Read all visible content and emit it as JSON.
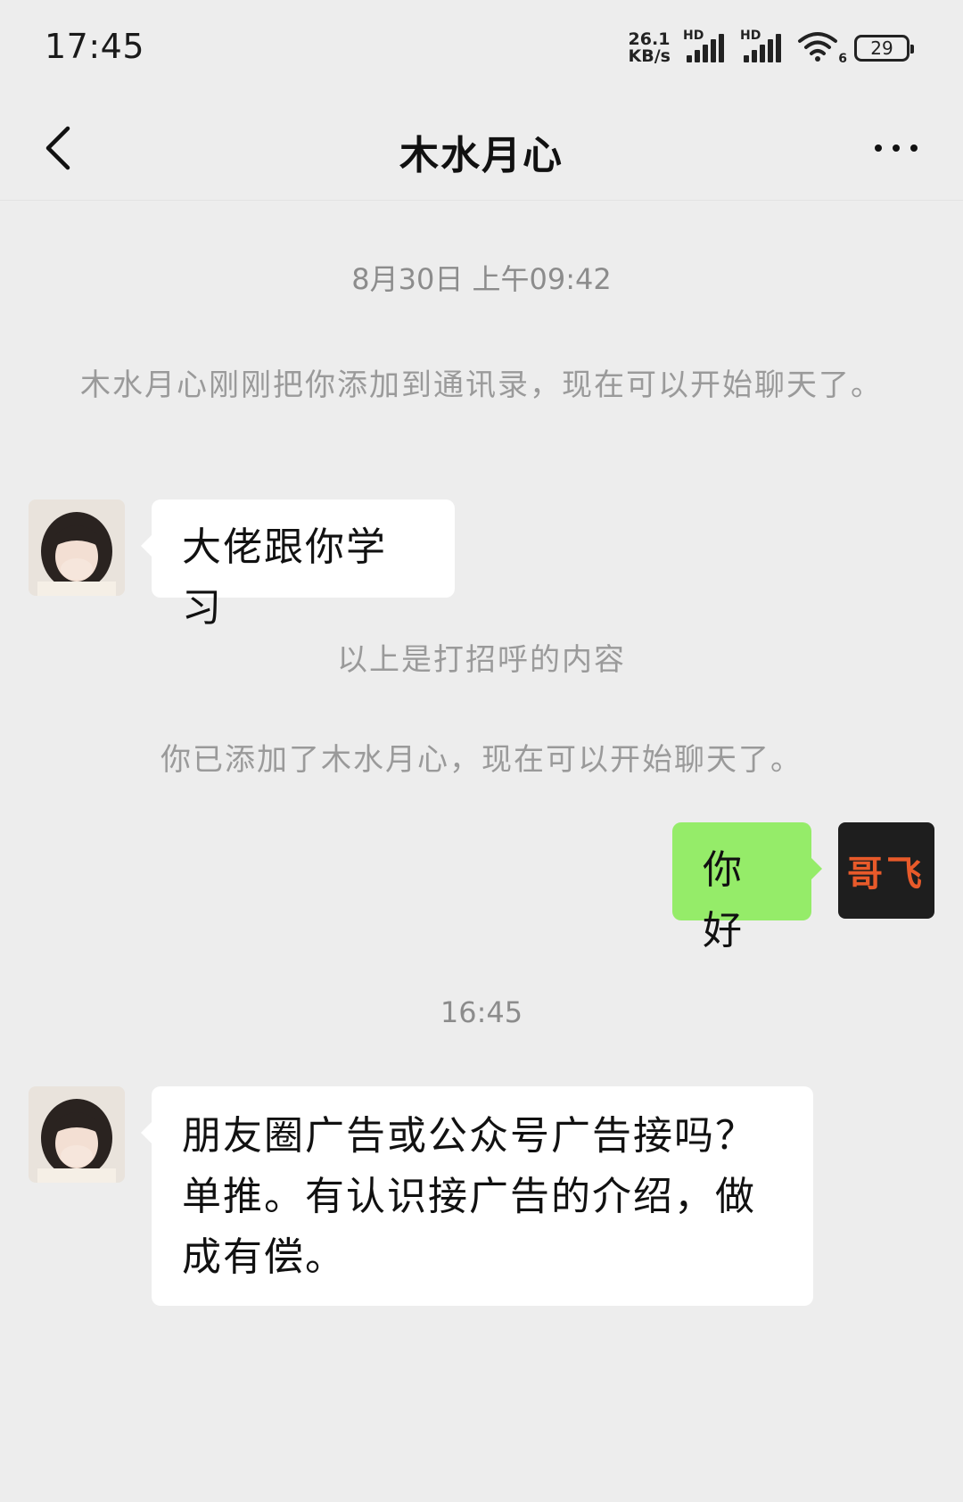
{
  "status_bar": {
    "time": "17:45",
    "net_speed_value": "26.1",
    "net_speed_unit": "KB/s",
    "sim1_label": "HD",
    "sim2_label": "HD",
    "wifi_label": "6",
    "battery": "29"
  },
  "header": {
    "title": "木水月心",
    "back_icon": "chevron-left-icon",
    "more_icon": "more-dots-icon"
  },
  "chat": {
    "timestamp_1": "8月30日 上午09:42",
    "system_added": "木水月心刚刚把你添加到通讯录，现在可以开始聊天了。",
    "greeting_message": "大佬跟你学习",
    "greeting_note": "以上是打招呼的内容",
    "system_added_you": "你已添加了木水月心，现在可以开始聊天了。",
    "my_message": "你好",
    "my_avatar_text": "哥飞",
    "timestamp_2": "16:45",
    "incoming_message": "朋友圈广告或公众号广告接吗？单推。有认识接广告的介绍，做成有偿。"
  },
  "colors": {
    "background": "#ededed",
    "incoming_bubble": "#ffffff",
    "outgoing_bubble": "#95ec69",
    "system_text": "#9a9a9a",
    "my_avatar_bg": "#1e1e1e",
    "my_avatar_text": "#e85a2a"
  }
}
